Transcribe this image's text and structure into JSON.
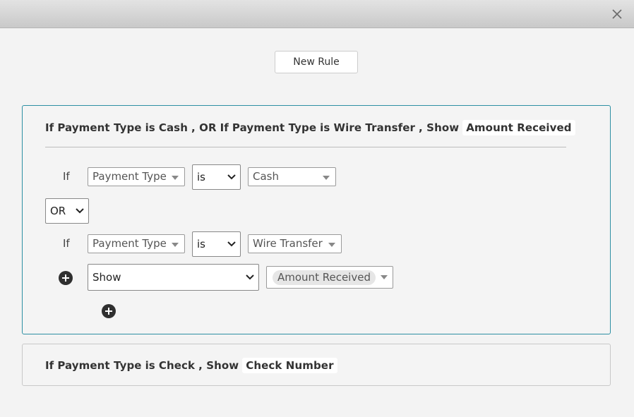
{
  "header": {
    "close_label": "Close"
  },
  "toolbar": {
    "new_rule_label": "New Rule"
  },
  "rules": [
    {
      "summary": {
        "p1": "If",
        "f1": "Payment Type",
        "op1": "is",
        "v1": "Cash",
        "join": ", OR",
        "p2": "If",
        "f2": "Payment Type",
        "op2": "is",
        "v2": "Wire Transfer",
        "action_prefix": ", Show",
        "action_target": "Amount Received"
      },
      "conditions": [
        {
          "prefix": "If",
          "field": "Payment Type",
          "operator": "is",
          "value": "Cash"
        },
        {
          "prefix": "If",
          "field": "Payment Type",
          "operator": "is",
          "value": "Wire Transfer"
        }
      ],
      "join_operator": "OR",
      "action": {
        "type": "Show",
        "target": "Amount Received"
      }
    },
    {
      "summary": {
        "p1": "If",
        "f1": "Payment Type",
        "op1": "is",
        "v1": "Check",
        "action_prefix": ", Show",
        "action_target": "Check Number"
      }
    }
  ]
}
